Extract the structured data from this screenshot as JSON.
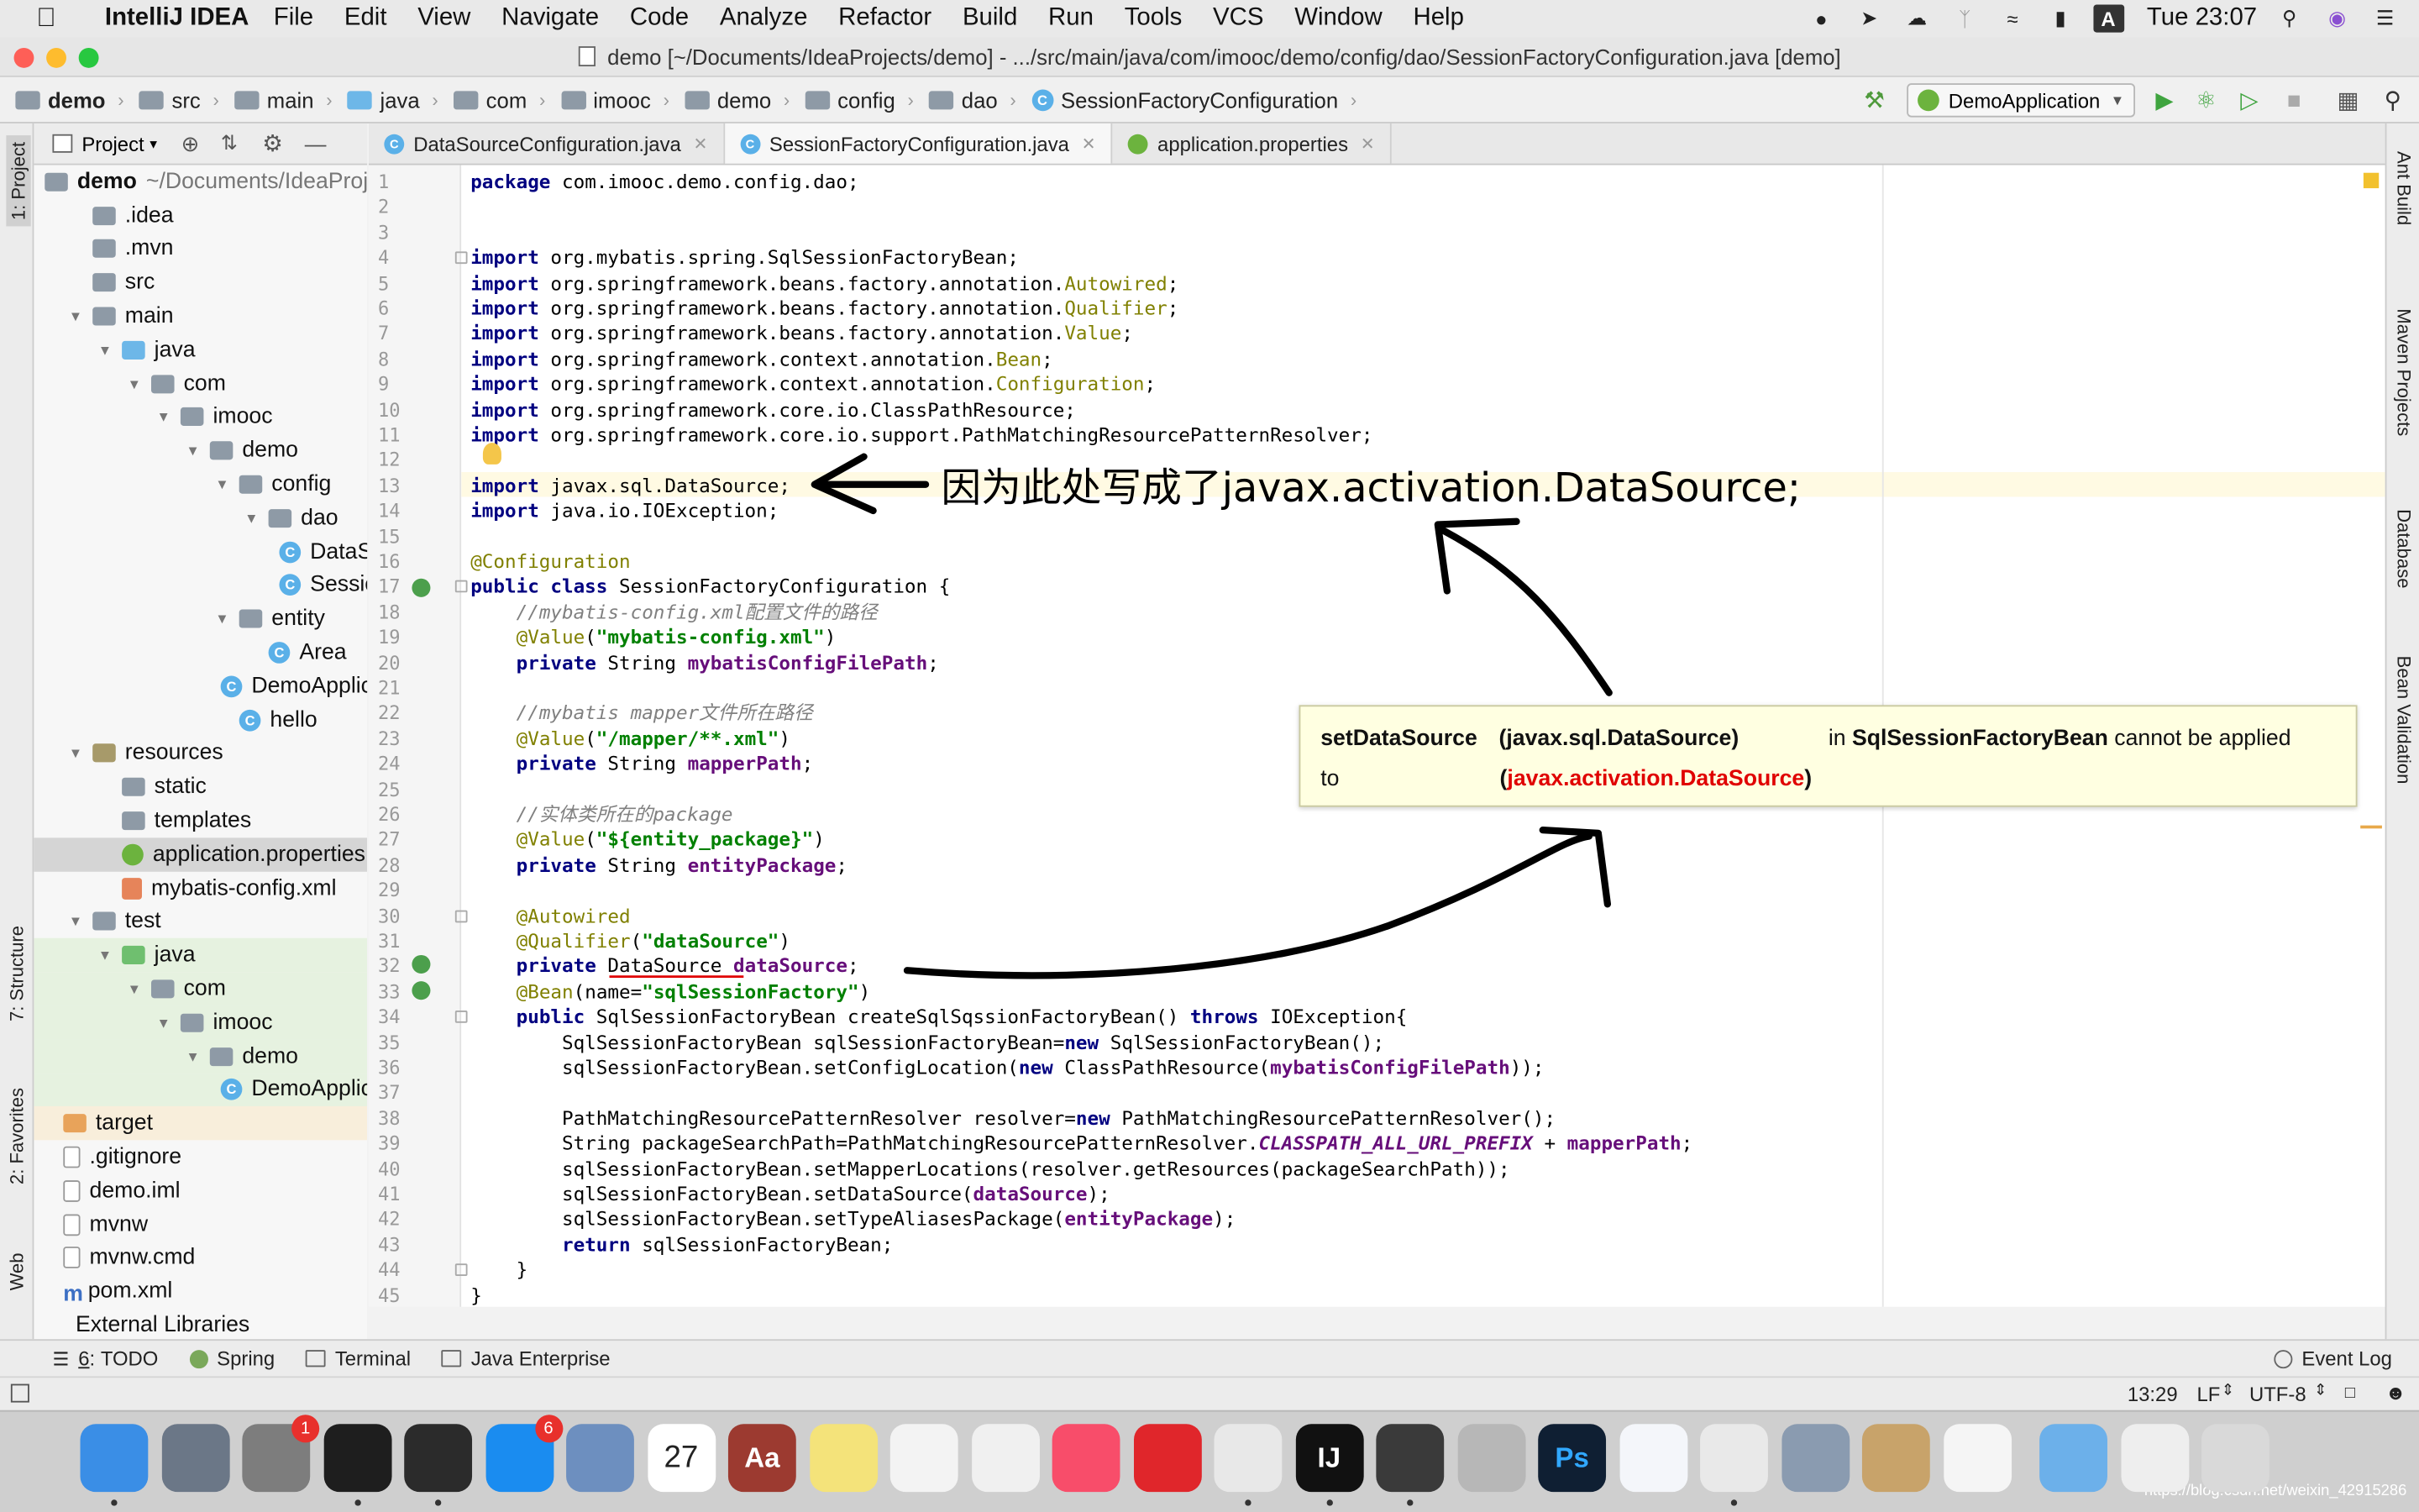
{
  "menubar": {
    "app_name": "IntelliJ IDEA",
    "items": [
      "File",
      "Edit",
      "View",
      "Navigate",
      "Code",
      "Analyze",
      "Refactor",
      "Build",
      "Run",
      "Tools",
      "VCS",
      "Window",
      "Help"
    ],
    "clock": "Tue 23:07"
  },
  "window": {
    "title": "demo [~/Documents/IdeaProjects/demo] - .../src/main/java/com/imooc/demo/config/dao/SessionFactoryConfiguration.java [demo]"
  },
  "breadcrumbs": [
    "demo",
    "src",
    "main",
    "java",
    "com",
    "imooc",
    "demo",
    "config",
    "dao",
    "SessionFactoryConfiguration"
  ],
  "run_config": "DemoApplication",
  "project_panel": {
    "header": "Project",
    "tree": [
      {
        "label": "demo",
        "detail": "~/Documents/IdeaProjects",
        "depth": 0,
        "kind": "root"
      },
      {
        "label": ".idea",
        "depth": 1,
        "kind": "folder"
      },
      {
        "label": ".mvn",
        "depth": 1,
        "kind": "folder"
      },
      {
        "label": "src",
        "depth": 1,
        "kind": "folder"
      },
      {
        "label": "main",
        "depth": 1,
        "kind": "folder",
        "arrow": "open"
      },
      {
        "label": "java",
        "depth": 2,
        "kind": "src",
        "arrow": "open"
      },
      {
        "label": "com",
        "depth": 3,
        "kind": "pkg",
        "arrow": "open"
      },
      {
        "label": "imooc",
        "depth": 4,
        "kind": "pkg",
        "arrow": "open"
      },
      {
        "label": "demo",
        "depth": 5,
        "kind": "pkg",
        "arrow": "open"
      },
      {
        "label": "config",
        "depth": 6,
        "kind": "pkg",
        "arrow": "open"
      },
      {
        "label": "dao",
        "depth": 7,
        "kind": "pkg",
        "arrow": "open"
      },
      {
        "label": "DataSc",
        "depth": 8,
        "kind": "class"
      },
      {
        "label": "Sessio",
        "depth": 8,
        "kind": "class"
      },
      {
        "label": "entity",
        "depth": 6,
        "kind": "pkg",
        "arrow": "open"
      },
      {
        "label": "Area",
        "depth": 7,
        "kind": "class"
      },
      {
        "label": "DemoApplica",
        "depth": 6,
        "kind": "class"
      },
      {
        "label": "hello",
        "depth": 6,
        "kind": "class"
      },
      {
        "label": "resources",
        "depth": 1,
        "kind": "res",
        "arrow": "open"
      },
      {
        "label": "static",
        "depth": 2,
        "kind": "folder"
      },
      {
        "label": "templates",
        "depth": 2,
        "kind": "folder"
      },
      {
        "label": "application.properties",
        "depth": 2,
        "kind": "prop",
        "selected": true
      },
      {
        "label": "mybatis-config.xml",
        "depth": 2,
        "kind": "xml"
      },
      {
        "label": "test",
        "depth": 1,
        "kind": "folder",
        "arrow": "open"
      },
      {
        "label": "java",
        "depth": 2,
        "kind": "test",
        "arrow": "open"
      },
      {
        "label": "com",
        "depth": 3,
        "kind": "pkg",
        "arrow": "open"
      },
      {
        "label": "imooc",
        "depth": 4,
        "kind": "pkg",
        "arrow": "open"
      },
      {
        "label": "demo",
        "depth": 5,
        "kind": "pkg",
        "arrow": "open"
      },
      {
        "label": "DemoApplica",
        "depth": 6,
        "kind": "class"
      },
      {
        "label": "target",
        "depth": 0,
        "kind": "target"
      },
      {
        "label": ".gitignore",
        "depth": 0,
        "kind": "file"
      },
      {
        "label": "demo.iml",
        "depth": 0,
        "kind": "file"
      },
      {
        "label": "mvnw",
        "depth": 0,
        "kind": "file"
      },
      {
        "label": "mvnw.cmd",
        "depth": 0,
        "kind": "file"
      },
      {
        "label": "pom.xml",
        "depth": 0,
        "kind": "maven"
      },
      {
        "label": "External Libraries",
        "depth": 0,
        "kind": "lib"
      }
    ]
  },
  "left_strip": {
    "project": "1: Project",
    "structure": "7: Structure",
    "favorites": "2: Favorites",
    "web": "Web"
  },
  "right_strip": {
    "ant": "Ant Build",
    "maven": "Maven Projects",
    "database": "Database",
    "bean": "Bean Validation"
  },
  "tabs": [
    {
      "label": "DataSourceConfiguration.java",
      "active": false,
      "icon": "C"
    },
    {
      "label": "SessionFactoryConfiguration.java",
      "active": true,
      "icon": "C"
    },
    {
      "label": "application.properties",
      "active": false,
      "icon": "leaf"
    }
  ],
  "code_lines": [
    [
      [
        "kw",
        "package"
      ],
      [
        "t",
        " com.imooc.demo.config.dao;"
      ]
    ],
    [],
    [],
    [
      [
        "kw",
        "import"
      ],
      [
        "t",
        " org.mybatis.spring.SqlSessionFactoryBean;"
      ]
    ],
    [
      [
        "kw",
        "import"
      ],
      [
        "t",
        " org.springframework.beans.factory.annotation."
      ],
      [
        "an",
        "Autowired"
      ],
      [
        "t",
        ";"
      ]
    ],
    [
      [
        "kw",
        "import"
      ],
      [
        "t",
        " org.springframework.beans.factory.annotation."
      ],
      [
        "an",
        "Qualifier"
      ],
      [
        "t",
        ";"
      ]
    ],
    [
      [
        "kw",
        "import"
      ],
      [
        "t",
        " org.springframework.beans.factory.annotation."
      ],
      [
        "an",
        "Value"
      ],
      [
        "t",
        ";"
      ]
    ],
    [
      [
        "kw",
        "import"
      ],
      [
        "t",
        " org.springframework.context.annotation."
      ],
      [
        "an",
        "Bean"
      ],
      [
        "t",
        ";"
      ]
    ],
    [
      [
        "kw",
        "import"
      ],
      [
        "t",
        " org.springframework.context.annotation."
      ],
      [
        "an",
        "Configuration"
      ],
      [
        "t",
        ";"
      ]
    ],
    [
      [
        "kw",
        "import"
      ],
      [
        "t",
        " org.springframework.core.io.ClassPathResource;"
      ]
    ],
    [
      [
        "kw",
        "import"
      ],
      [
        "t",
        " org.springframework.core.io.support.PathMatchingResourcePatternResolver;"
      ]
    ],
    [],
    [
      [
        "kw",
        "import"
      ],
      [
        "t",
        " javax.sql.DataSource;"
      ]
    ],
    [
      [
        "kw",
        "import"
      ],
      [
        "t",
        " java.io.IOException;"
      ]
    ],
    [],
    [
      [
        "an",
        "@Configuration"
      ]
    ],
    [
      [
        "kw",
        "public class"
      ],
      [
        "t",
        " SessionFactoryConfiguration {"
      ]
    ],
    [
      [
        "t",
        "    "
      ],
      [
        "cm",
        "//mybatis-config.xml配置文件的路径"
      ]
    ],
    [
      [
        "t",
        "    "
      ],
      [
        "an",
        "@Value"
      ],
      [
        "t",
        "("
      ],
      [
        "st",
        "\"mybatis-config.xml\""
      ],
      [
        "t",
        ")"
      ]
    ],
    [
      [
        "t",
        "    "
      ],
      [
        "kw",
        "private"
      ],
      [
        "t",
        " String "
      ],
      [
        "fd",
        "mybatisConfigFilePath"
      ],
      [
        "t",
        ";"
      ]
    ],
    [],
    [
      [
        "t",
        "    "
      ],
      [
        "cm",
        "//mybatis mapper文件所在路径"
      ]
    ],
    [
      [
        "t",
        "    "
      ],
      [
        "an",
        "@Value"
      ],
      [
        "t",
        "("
      ],
      [
        "st",
        "\"/mapper/**.xml\""
      ],
      [
        "t",
        ")"
      ]
    ],
    [
      [
        "t",
        "    "
      ],
      [
        "kw",
        "private"
      ],
      [
        "t",
        " String "
      ],
      [
        "fd",
        "mapperPath"
      ],
      [
        "t",
        ";"
      ]
    ],
    [],
    [
      [
        "t",
        "    "
      ],
      [
        "cm",
        "//实体类所在的package"
      ]
    ],
    [
      [
        "t",
        "    "
      ],
      [
        "an",
        "@Value"
      ],
      [
        "t",
        "("
      ],
      [
        "st",
        "\"${entity_package}\""
      ],
      [
        "t",
        ")"
      ]
    ],
    [
      [
        "t",
        "    "
      ],
      [
        "kw",
        "private"
      ],
      [
        "t",
        " String "
      ],
      [
        "fd",
        "entityPackage"
      ],
      [
        "t",
        ";"
      ]
    ],
    [],
    [
      [
        "t",
        "    "
      ],
      [
        "an",
        "@Autowired"
      ]
    ],
    [
      [
        "t",
        "    "
      ],
      [
        "an",
        "@Qualifier"
      ],
      [
        "t",
        "("
      ],
      [
        "st",
        "\"dataSource\""
      ],
      [
        "t",
        ")"
      ]
    ],
    [
      [
        "t",
        "    "
      ],
      [
        "kw",
        "private"
      ],
      [
        "t",
        " DataSource "
      ],
      [
        "fd",
        "dataSource"
      ],
      [
        "t",
        ";"
      ]
    ],
    [
      [
        "t",
        "    "
      ],
      [
        "an",
        "@Bean"
      ],
      [
        "t",
        "(name="
      ],
      [
        "st",
        "\"sqlSessionFactory\""
      ],
      [
        "t",
        ")"
      ]
    ],
    [
      [
        "t",
        "    "
      ],
      [
        "kw",
        "public"
      ],
      [
        "t",
        " SqlSessionFactoryBean createSqlSqssionFactoryBean() "
      ],
      [
        "kw",
        "throws"
      ],
      [
        "t",
        " IOException{"
      ]
    ],
    [
      [
        "t",
        "        SqlSessionFactoryBean sqlSessionFactoryBean="
      ],
      [
        "kw",
        "new"
      ],
      [
        "t",
        " SqlSessionFactoryBean();"
      ]
    ],
    [
      [
        "t",
        "        sqlSessionFactoryBean.setConfigLocation("
      ],
      [
        "kw",
        "new"
      ],
      [
        "t",
        " ClassPathResource("
      ],
      [
        "fd",
        "mybatisConfigFilePath"
      ],
      [
        "t",
        "));"
      ]
    ],
    [],
    [
      [
        "t",
        "        PathMatchingResourcePatternResolver resolver="
      ],
      [
        "kw",
        "new"
      ],
      [
        "t",
        " PathMatchingResourcePatternResolver();"
      ]
    ],
    [
      [
        "t",
        "        String packageSearchPath=PathMatchingResourcePatternResolver."
      ],
      [
        "sf",
        "CLASSPATH_ALL_URL_PREFIX"
      ],
      [
        "t",
        " + "
      ],
      [
        "fd",
        "mapperPath"
      ],
      [
        "t",
        ";"
      ]
    ],
    [
      [
        "t",
        "        sqlSessionFactoryBean.setMapperLocations(resolver.getResources(packageSearchPath));"
      ]
    ],
    [
      [
        "t",
        "        sqlSessionFactoryBean.setDataSource("
      ],
      [
        "fd",
        "dataSource"
      ],
      [
        "t",
        ");"
      ]
    ],
    [
      [
        "t",
        "        sqlSessionFactoryBean.setTypeAliasesPackage("
      ],
      [
        "fd",
        "entityPackage"
      ],
      [
        "t",
        ");"
      ]
    ],
    [
      [
        "t",
        "        "
      ],
      [
        "kw",
        "return"
      ],
      [
        "t",
        " sqlSessionFactoryBean;"
      ]
    ],
    [
      [
        "t",
        "    }"
      ]
    ],
    [
      [
        "t",
        "}"
      ]
    ]
  ],
  "tooltip": {
    "method": "setDataSource",
    "param": "(javax.sql.DataSource)",
    "in_word": "in",
    "cls": "SqlSessionFactoryBean",
    "tail": "cannot be applied",
    "to": "to",
    "arg_open": "(",
    "arg": "javax.activation.DataSource",
    "arg_close": ")"
  },
  "annotation_text": "因为此处写成了javax.activation.DataSource;",
  "bottom_tabs": [
    {
      "num": "6",
      "label": "TODO"
    },
    {
      "num": "",
      "label": "Spring"
    },
    {
      "num": "",
      "label": "Terminal"
    },
    {
      "num": "",
      "label": "Java Enterprise"
    }
  ],
  "event_log": "Event Log",
  "status": {
    "position": "13:29",
    "line_sep": "LF",
    "encoding": "UTF-8"
  },
  "dock": {
    "items": [
      {
        "name": "Finder",
        "color": "#3a8ee6"
      },
      {
        "name": "Launchpad",
        "color": "#6b7787"
      },
      {
        "name": "System Preferences",
        "color": "#7d7d7d",
        "badge": "1"
      },
      {
        "name": "Terminal",
        "color": "#1e1e1e"
      },
      {
        "name": "Activity Monitor",
        "color": "#2b2b2b"
      },
      {
        "name": "App Store",
        "color": "#1a8cf0",
        "badge": "6"
      },
      {
        "name": "Preview",
        "color": "#6d8fbf"
      },
      {
        "name": "Calendar",
        "color": "#ffffff",
        "text": "27"
      },
      {
        "name": "Dictionary",
        "color": "#9c3a30",
        "text": "Aa"
      },
      {
        "name": "Notes",
        "color": "#f4e37a"
      },
      {
        "name": "Reminders",
        "color": "#f3f3f3"
      },
      {
        "name": "Photos",
        "color": "#f0f0f0"
      },
      {
        "name": "Music",
        "color": "#f84d6a"
      },
      {
        "name": "NetEase Music",
        "color": "#e0262b"
      },
      {
        "name": "Chrome",
        "color": "#e8e8e8"
      },
      {
        "name": "IntelliJ IDEA",
        "color": "#111111",
        "text": "IJ"
      },
      {
        "name": "Sublime Text",
        "color": "#3a3a3a"
      },
      {
        "name": "Disk Utility",
        "color": "#b7b7b7"
      },
      {
        "name": "Photoshop",
        "color": "#0f1f33",
        "text": "Ps"
      },
      {
        "name": "Baidu Netdisk",
        "color": "#f4f6fa"
      },
      {
        "name": "WeChat",
        "color": "#e9e9e9"
      },
      {
        "name": "Photo Viewer",
        "color": "#8a9bb0"
      },
      {
        "name": "Archive",
        "color": "#c8a36a"
      },
      {
        "name": "TextEdit",
        "color": "#f5f5f5"
      },
      {
        "name": "Downloads",
        "color": "#6cb0ea"
      },
      {
        "name": "Documents",
        "color": "#eeeeee"
      },
      {
        "name": "Trash",
        "color": "#d9d9d9"
      }
    ],
    "watermark": "https://blog.csdn.net/weixin_42915286"
  },
  "colors": {
    "accent": "#2675bf",
    "error": "#e00000",
    "tooltip_bg": "#ffffe1",
    "caret_line": "#fffae3"
  }
}
